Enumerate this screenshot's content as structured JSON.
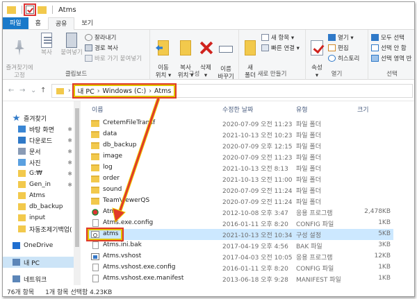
{
  "window": {
    "title": "Atms"
  },
  "ribbon_tabs": [
    "파일",
    "홈",
    "공유",
    "보기"
  ],
  "ribbon": {
    "clipboard": {
      "label": "클립보드",
      "pin": "즐겨찾기에\n고정",
      "copy": "복사",
      "paste": "붙여넣기",
      "cut": "잘라내기",
      "copy_path": "경로 복사",
      "paste_shortcut": "바로 가기 붙여넣기"
    },
    "organize": {
      "label": "구성",
      "move_to": "이동\n위치 ▾",
      "copy_to": "복사\n위치 ▾",
      "delete": "삭제\n▾",
      "rename": "이름\n바꾸기"
    },
    "new": {
      "label": "새로 만들기",
      "new_folder": "새\n폴더",
      "new_item": "새 항목 ▾",
      "easy_access": "빠른 연결 ▾"
    },
    "open": {
      "label": "열기",
      "properties": "속성\n▾",
      "open": "열기 ▾",
      "edit": "편집",
      "history": "히스토리"
    },
    "select": {
      "label": "선택",
      "select_all": "모두 선택",
      "select_none": "선택 안 함",
      "invert": "선택 영역 반"
    }
  },
  "address": {
    "back": "←",
    "forward": "→",
    "recent": "⌄",
    "up": "↑",
    "crumbs": [
      "내 PC",
      "Windows (C:)",
      "Atms"
    ],
    "sep": "›"
  },
  "nav": {
    "items": [
      {
        "label": "즐겨찾기",
        "icon": "star-icon",
        "pinned": false
      },
      {
        "label": "바탕 화면",
        "icon": "desktop-icon",
        "pinned": true
      },
      {
        "label": "다운로드",
        "icon": "download-icon",
        "pinned": true
      },
      {
        "label": "문서",
        "icon": "documents-icon",
        "pinned": true
      },
      {
        "label": "사진",
        "icon": "pictures-icon",
        "pinned": true
      },
      {
        "label": "G:₩",
        "icon": "folder-icon",
        "pinned": true
      },
      {
        "label": "Gen_in",
        "icon": "folder-icon",
        "pinned": true
      },
      {
        "label": "Atms",
        "icon": "folder-icon",
        "pinned": false
      },
      {
        "label": "db_backup",
        "icon": "folder-icon",
        "pinned": false
      },
      {
        "label": "input",
        "icon": "folder-icon",
        "pinned": false
      },
      {
        "label": "자동조제기백업(",
        "icon": "folder-icon",
        "pinned": false
      },
      {
        "label": "OneDrive",
        "icon": "onedrive-icon",
        "pinned": false
      },
      {
        "label": "내 PC",
        "icon": "pc-icon",
        "pinned": false
      },
      {
        "label": "네트워크",
        "icon": "network-icon",
        "pinned": false
      }
    ],
    "pin_glyph": "✱"
  },
  "columns": {
    "name": "이름",
    "date": "수정한 날짜",
    "type": "유형",
    "size": "크기"
  },
  "files": [
    {
      "name": "CretemFileTransf",
      "date": "2020-07-09 오전 11:23",
      "type": "파일 폴더",
      "size": "",
      "kind": "folder"
    },
    {
      "name": "data",
      "date": "2021-10-13 오전 10:23",
      "type": "파일 폴더",
      "size": "",
      "kind": "folder"
    },
    {
      "name": "db_backup",
      "date": "2020-07-09 오후 12:15",
      "type": "파일 폴더",
      "size": "",
      "kind": "folder"
    },
    {
      "name": "image",
      "date": "2020-07-09 오전 11:23",
      "type": "파일 폴더",
      "size": "",
      "kind": "folder"
    },
    {
      "name": "log",
      "date": "2021-10-13 오전 8:13",
      "type": "파일 폴더",
      "size": "",
      "kind": "folder"
    },
    {
      "name": "order",
      "date": "2021-10-13 오전 11:00",
      "type": "파일 폴더",
      "size": "",
      "kind": "folder"
    },
    {
      "name": "sound",
      "date": "2020-07-09 오전 11:24",
      "type": "파일 폴더",
      "size": "",
      "kind": "folder"
    },
    {
      "name": "TeamViewerQS",
      "date": "2020-07-09 오전 11:24",
      "type": "파일 폴더",
      "size": "",
      "kind": "folder"
    },
    {
      "name": "Atms",
      "date": "2012-10-08 오후 3:47",
      "type": "응용 프로그램",
      "size": "2,478KB",
      "kind": "exe"
    },
    {
      "name": "Atms.exe.config",
      "date": "2016-01-11 오후 8:20",
      "type": "CONFIG 파일",
      "size": "1KB",
      "kind": "file"
    },
    {
      "name": "atms",
      "date": "2021-10-13 오전 10:34",
      "type": "구성 설정",
      "size": "5KB",
      "kind": "ini"
    },
    {
      "name": "Atms.ini.bak",
      "date": "2017-04-19 오후 4:56",
      "type": "BAK 파일",
      "size": "3KB",
      "kind": "file"
    },
    {
      "name": "Atms.vshost",
      "date": "2017-04-03 오전 10:05",
      "type": "응용 프로그램",
      "size": "12KB",
      "kind": "app"
    },
    {
      "name": "Atms.vshost.exe.config",
      "date": "2016-01-11 오후 8:20",
      "type": "CONFIG 파일",
      "size": "1KB",
      "kind": "file"
    },
    {
      "name": "Atms.vshost.exe.manifest",
      "date": "2013-06-18 오후 9:28",
      "type": "MANIFEST 파일",
      "size": "1KB",
      "kind": "file"
    }
  ],
  "status": {
    "count": "76개 항목",
    "selection": "1개 항목 선택함 4.23KB"
  },
  "colors": {
    "accent": "#1979ca",
    "highlight_yellow": "#e0c400",
    "highlight_red": "#e03a2a",
    "arrow": "#e03a2a"
  }
}
